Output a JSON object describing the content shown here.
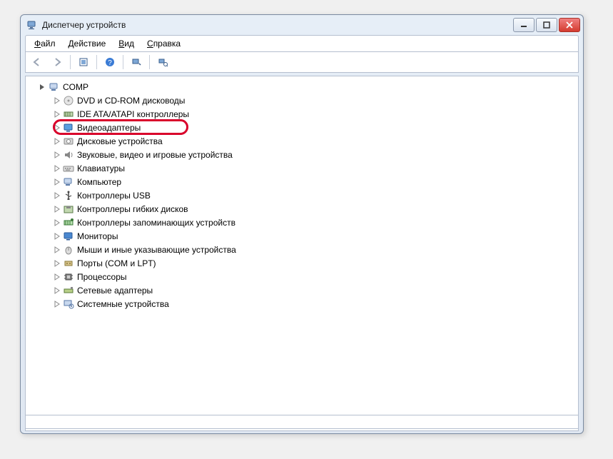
{
  "window": {
    "title": "Диспетчер устройств"
  },
  "menu": {
    "file": "Файл",
    "action": "Действие",
    "view": "Вид",
    "help": "Справка"
  },
  "toolbar_icons": {
    "back": "arrow-left",
    "forward": "arrow-right",
    "show_hidden": "show-hidden",
    "help": "help",
    "scan": "scan-hardware",
    "properties": "properties"
  },
  "tree": {
    "root": {
      "label": "COMP",
      "expanded": true
    },
    "items": [
      {
        "label": "DVD и CD-ROM дисководы",
        "icon": "disc"
      },
      {
        "label": "IDE ATA/ATAPI контроллеры",
        "icon": "ide"
      },
      {
        "label": "Видеоадаптеры",
        "icon": "display",
        "highlight": true
      },
      {
        "label": "Дисковые устройства",
        "icon": "disk"
      },
      {
        "label": "Звуковые, видео и игровые устройства",
        "icon": "sound"
      },
      {
        "label": "Клавиатуры",
        "icon": "keyboard"
      },
      {
        "label": "Компьютер",
        "icon": "computer"
      },
      {
        "label": "Контроллеры USB",
        "icon": "usb"
      },
      {
        "label": "Контроллеры гибких дисков",
        "icon": "floppy-ctl"
      },
      {
        "label": "Контроллеры запоминающих устройств",
        "icon": "storage-ctl"
      },
      {
        "label": "Мониторы",
        "icon": "monitor"
      },
      {
        "label": "Мыши и иные указывающие устройства",
        "icon": "mouse"
      },
      {
        "label": "Порты (COM и LPT)",
        "icon": "port"
      },
      {
        "label": "Процессоры",
        "icon": "cpu"
      },
      {
        "label": "Сетевые адаптеры",
        "icon": "network"
      },
      {
        "label": "Системные устройства",
        "icon": "system"
      }
    ]
  }
}
